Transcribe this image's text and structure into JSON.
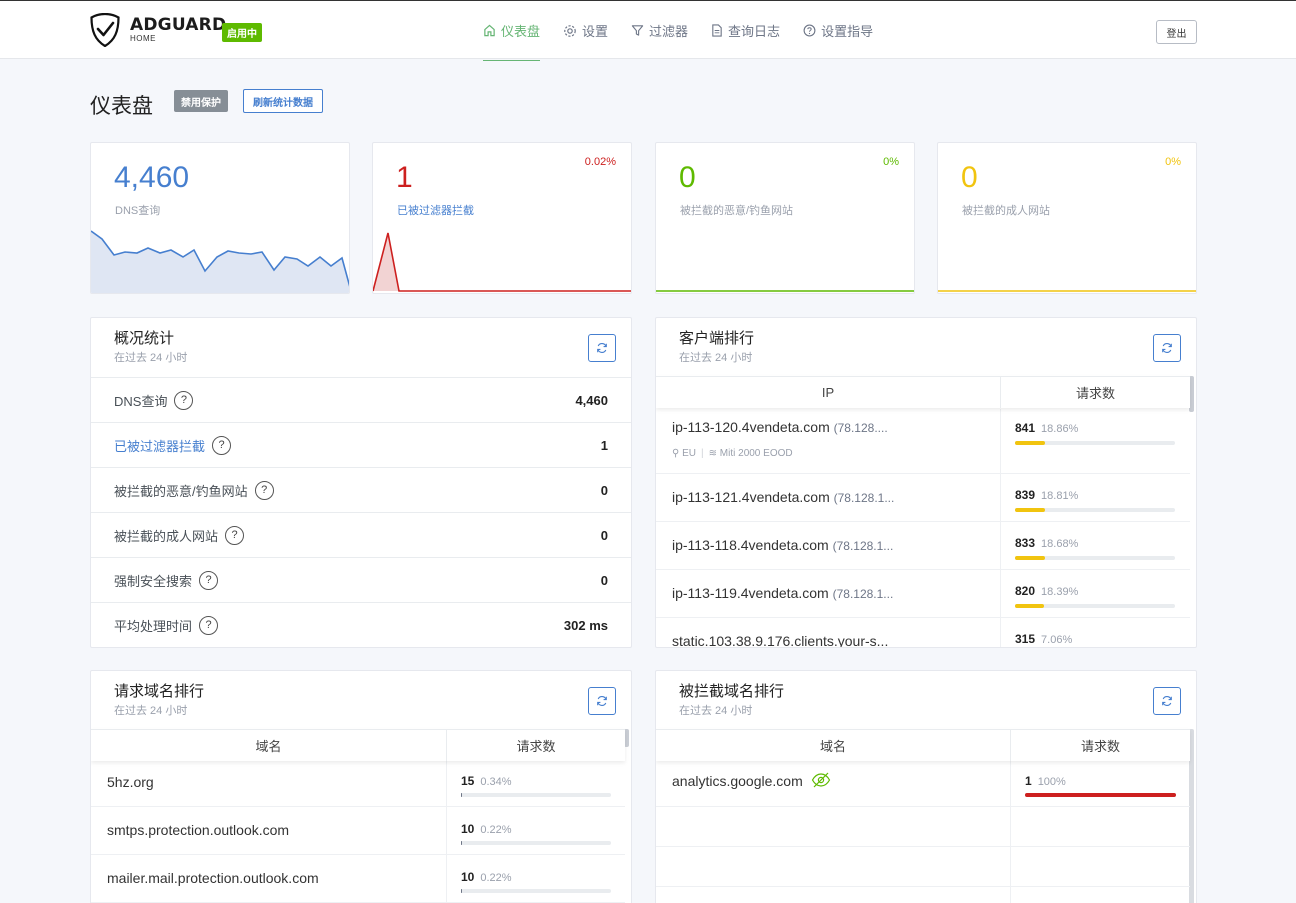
{
  "header": {
    "brand": "ADGUARD",
    "brand_sub": "HOME",
    "status": "启用中",
    "nav": [
      {
        "label": "仪表盘",
        "icon": "home-icon",
        "active": true
      },
      {
        "label": "设置",
        "icon": "gear-icon",
        "active": false
      },
      {
        "label": "过滤器",
        "icon": "filter-icon",
        "active": false
      },
      {
        "label": "查询日志",
        "icon": "document-icon",
        "active": false
      },
      {
        "label": "设置指导",
        "icon": "help-icon",
        "active": false
      }
    ],
    "logout": "登出"
  },
  "page": {
    "title": "仪表盘",
    "disable_protection": "禁用保护",
    "refresh_stats": "刷新统计数据"
  },
  "stat_cards": [
    {
      "value": "4,460",
      "label": "DNS查询",
      "percent": "",
      "color": "#467fcf"
    },
    {
      "value": "1",
      "label": "已被过滤器拦截",
      "percent": "0.02%",
      "color": "#cd201f"
    },
    {
      "value": "0",
      "label": "被拦截的恶意/钓鱼网站",
      "percent": "0%",
      "color": "#5eba00"
    },
    {
      "value": "0",
      "label": "被拦截的成人网站",
      "percent": "0%",
      "color": "#f1c40f"
    }
  ],
  "overview": {
    "title": "概况统计",
    "subtitle": "在过去 24 小时",
    "rows": [
      {
        "label": "DNS查询",
        "value": "4,460"
      },
      {
        "label": "已被过滤器拦截",
        "value": "1"
      },
      {
        "label": "被拦截的恶意/钓鱼网站",
        "value": "0"
      },
      {
        "label": "被拦截的成人网站",
        "value": "0"
      },
      {
        "label": "强制安全搜索",
        "value": "0"
      },
      {
        "label": "平均处理时间",
        "value": "302 ms"
      }
    ]
  },
  "clients": {
    "title": "客户端排行",
    "subtitle": "在过去 24 小时",
    "col_ip": "IP",
    "col_count": "请求数",
    "rows": [
      {
        "name": "ip-113-120.4vendeta.com",
        "ip": "(78.128....",
        "count": "841",
        "percent": "18.86%",
        "fill": 0.1886,
        "location": "EU",
        "org": "Miti 2000 EOOD"
      },
      {
        "name": "ip-113-121.4vendeta.com",
        "ip": "(78.128.1...",
        "count": "839",
        "percent": "18.81%",
        "fill": 0.1881
      },
      {
        "name": "ip-113-118.4vendeta.com",
        "ip": "(78.128.1...",
        "count": "833",
        "percent": "18.68%",
        "fill": 0.1868
      },
      {
        "name": "ip-113-119.4vendeta.com",
        "ip": "(78.128.1...",
        "count": "820",
        "percent": "18.39%",
        "fill": 0.1839
      },
      {
        "name": "static.103.38.9.176.clients.your-s...",
        "ip": "",
        "count": "315",
        "percent": "7.06%",
        "fill": 0.0706
      }
    ]
  },
  "queried_domains": {
    "title": "请求域名排行",
    "subtitle": "在过去 24 小时",
    "col_domain": "域名",
    "col_count": "请求数",
    "rows": [
      {
        "domain": "5hz.org",
        "count": "15",
        "percent": "0.34%",
        "fill": 0.0034
      },
      {
        "domain": "smtps.protection.outlook.com",
        "count": "10",
        "percent": "0.22%",
        "fill": 0.0022
      },
      {
        "domain": "mailer.mail.protection.outlook.com",
        "count": "10",
        "percent": "0.22%",
        "fill": 0.0022
      }
    ]
  },
  "blocked_domains": {
    "title": "被拦截域名排行",
    "subtitle": "在过去 24 小时",
    "col_domain": "域名",
    "col_count": "请求数",
    "rows": [
      {
        "domain": "analytics.google.com",
        "count": "1",
        "percent": "100%",
        "fill": 1.0
      }
    ]
  },
  "colors": {
    "accent_green": "#66b574",
    "blue": "#467fcf",
    "red": "#cd201f",
    "green": "#5eba00",
    "yellow": "#f1c40f"
  }
}
